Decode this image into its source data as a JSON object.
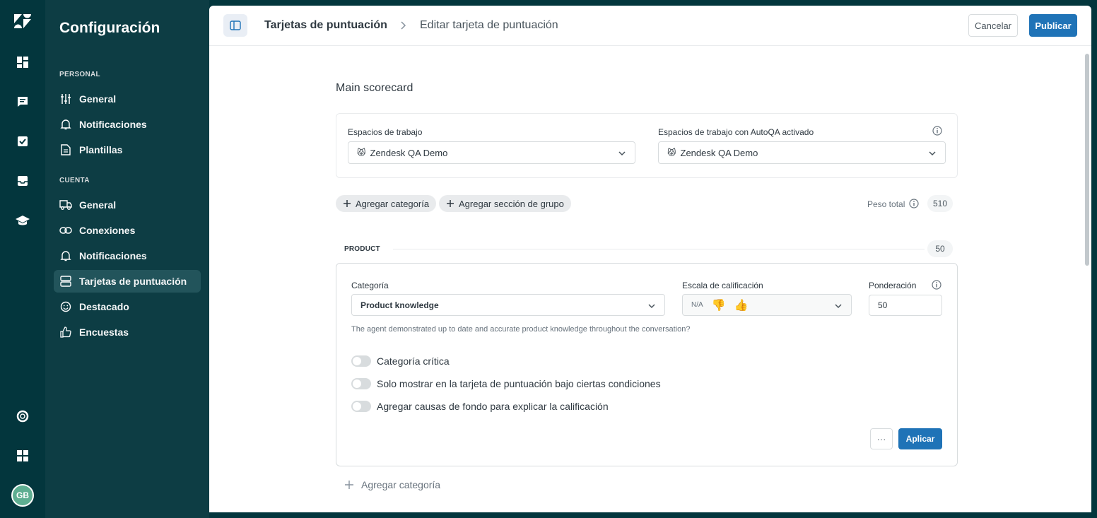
{
  "sidebar": {
    "title": "Configuración",
    "sections": {
      "personal": "PERSONAL",
      "account": "CUENTA"
    },
    "personal_items": [
      {
        "label": "General",
        "icon": "sliders-icon"
      },
      {
        "label": "Notificaciones",
        "icon": "bell-icon"
      },
      {
        "label": "Plantillas",
        "icon": "document-icon"
      }
    ],
    "account_items": [
      {
        "label": "General",
        "icon": "truck-icon"
      },
      {
        "label": "Conexiones",
        "icon": "link-icon"
      },
      {
        "label": "Notificaciones",
        "icon": "bell-icon"
      },
      {
        "label": "Tarjetas de puntuación",
        "icon": "scorecard-icon",
        "active": true
      },
      {
        "label": "Destacado",
        "icon": "smiley-icon"
      },
      {
        "label": "Encuestas",
        "icon": "thumbs-up-icon"
      }
    ]
  },
  "rail": {
    "avatar_initials": "GB"
  },
  "header": {
    "breadcrumb_parent": "Tarjetas de puntuación",
    "breadcrumb_current": "Editar tarjeta de puntuación",
    "cancel_label": "Cancelar",
    "publish_label": "Publicar"
  },
  "scorecard": {
    "name": "Main scorecard",
    "workspaces_label": "Espacios de trabajo",
    "workspaces_value": "Zendesk QA Demo",
    "autoqa_label": "Espacios de trabajo con AutoQA activado",
    "autoqa_value": "Zendesk QA Demo",
    "workspace_emoji": "😾",
    "add_category_label": "Agregar categoría",
    "add_group_label": "Agregar sección de grupo",
    "total_weight_label": "Peso total",
    "total_weight_value": "510"
  },
  "section": {
    "name": "PRODUCT",
    "weight": "50"
  },
  "category": {
    "category_label": "Categoría",
    "category_value": "Product knowledge",
    "scale_label": "Escala de calificación",
    "scale_na": "N/A",
    "scale_down": "👎",
    "scale_up": "👍",
    "weight_label": "Ponderación",
    "weight_value": "50",
    "description": "The agent demonstrated up to date and accurate product knowledge throughout the conversation?",
    "toggles": [
      {
        "label": "Categoría crítica",
        "on": false
      },
      {
        "label": "Solo mostrar en la tarjeta de puntuación bajo ciertas condiciones",
        "on": false
      },
      {
        "label": "Agregar causas de fondo para explicar la calificación",
        "on": false
      }
    ],
    "more_label": "···",
    "apply_label": "Aplicar"
  },
  "footer": {
    "add_category_label": "Agregar categoría"
  },
  "colors": {
    "brand_dark": "#03363d",
    "sidebar": "#0d3d44",
    "primary": "#1f73b7"
  }
}
